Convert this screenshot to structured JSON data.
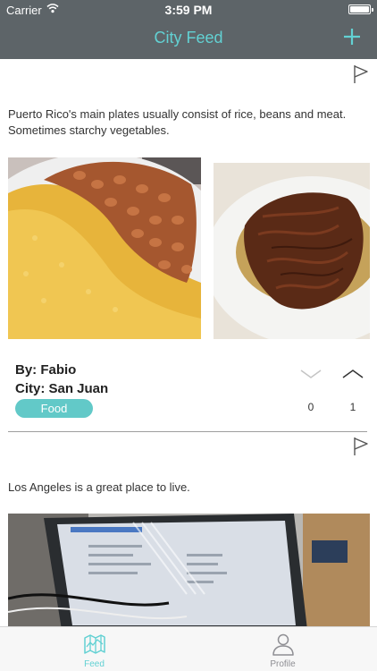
{
  "status_bar": {
    "carrier": "Carrier",
    "time": "3:59 PM",
    "wifi_icon": "wifi-icon",
    "battery_icon": "battery-icon"
  },
  "nav": {
    "title": "City Feed",
    "add_icon": "plus-icon"
  },
  "colors": {
    "accent": "#62d1d3",
    "nav_bar": "#5d6468",
    "tag_bg": "#62c9c8",
    "tab_inactive": "#8e8e93"
  },
  "posts": [
    {
      "description": "Puerto Rico's main plates usually consist of rice, beans and meat. Sometimes starchy vegetables.",
      "photos": [
        "rice-and-beans-photo",
        "shredded-meat-photo"
      ],
      "author": "By: Fabio",
      "city": "City: San Juan",
      "tag": "Food",
      "downvotes": "0",
      "upvotes": "1"
    },
    {
      "description": "Los Angeles is a great place to live.",
      "photos": [
        "laptop-photo"
      ]
    }
  ],
  "tabs": [
    {
      "label": "Feed",
      "icon": "map-icon",
      "active": true
    },
    {
      "label": "Profile",
      "icon": "person-icon",
      "active": false
    }
  ]
}
